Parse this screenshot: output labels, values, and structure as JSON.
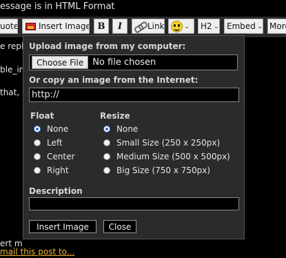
{
  "header": {
    "format_notice": "essage is in HTML Format"
  },
  "toolbar": {
    "quote_label": "uote",
    "insert_image_label": "Insert Image",
    "bold_label": "B",
    "italic_label": "I",
    "link_label": "Link",
    "heading_label": "H2",
    "embed_label": "Embed",
    "more_label": "More"
  },
  "background_text": {
    "line1": "e repl",
    "line2": "ble_in",
    "line3": "that,",
    "bottom_line": "ert m",
    "email_link": "mail this post to..."
  },
  "dialog": {
    "upload_label": "Upload image from my computer:",
    "choose_file_label": "Choose File",
    "no_file_text": "No file chosen",
    "internet_label": "Or copy an image from the Internet:",
    "url_value": "http://",
    "float_label": "Float",
    "float_options": [
      "None",
      "Left",
      "Center",
      "Right"
    ],
    "resize_label": "Resize",
    "resize_options": [
      "None",
      "Small Size (250 x 250px)",
      "Medium Size (500 x 500px)",
      "Big Size (750 x 750px)"
    ],
    "description_label": "Description",
    "description_value": "",
    "insert_button": "Insert Image",
    "close_button": "Close"
  },
  "colors": {
    "link": "#f3b530",
    "selected_radio": "#2f66c4"
  }
}
